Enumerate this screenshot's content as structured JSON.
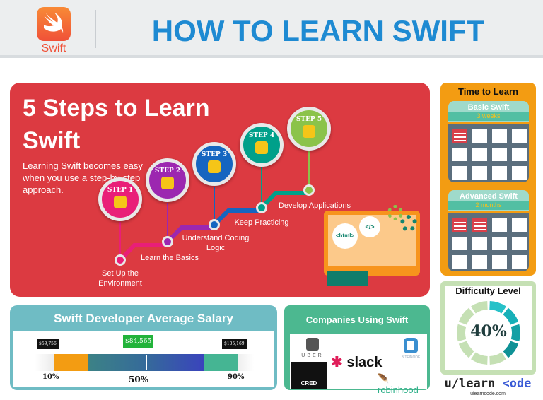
{
  "header": {
    "logo_text": "Swift",
    "title": "HOW TO LEARN SWIFT"
  },
  "steps_panel": {
    "title": "5 Steps to Learn Swift",
    "subtitle": "Learning Swift becomes easy when you use a step-by-step approach.",
    "steps": [
      {
        "badge": "STEP 1",
        "label": "Set Up the Environment",
        "color": "#e91e78",
        "icon": "lightbulb-icon"
      },
      {
        "badge": "STEP 2",
        "label": "Learn the Basics",
        "color": "#9c27b0",
        "icon": "presentation-chart-icon"
      },
      {
        "badge": "STEP 3",
        "label": "Understand Coding Logic",
        "color": "#1565c0",
        "icon": "magnifier-code-icon"
      },
      {
        "badge": "STEP 4",
        "label": "Keep Practicing",
        "color": "#00a08a",
        "icon": "notebook-icon"
      },
      {
        "badge": "STEP 5",
        "label": "Develop Applications",
        "color": "#8bc34a",
        "icon": "globe-gear-icon"
      }
    ],
    "illustration": {
      "html_tag": "<html>",
      "code_tag": "</>"
    }
  },
  "time_to_learn": {
    "title": "Time to Learn",
    "cards": [
      {
        "name": "Basic Swift",
        "duration": "3 weeks",
        "marked": 1
      },
      {
        "name": "Advanced Swift",
        "duration": "2 months",
        "marked": 2
      }
    ]
  },
  "difficulty": {
    "title": "Difficulty Level",
    "value": "40%",
    "percent": 40
  },
  "salary": {
    "title": "Swift Developer Average Salary",
    "markers": [
      {
        "value": "$59,756",
        "percentile": "10%"
      },
      {
        "value": "$84,565",
        "percentile": "50%"
      },
      {
        "value": "$105,169",
        "percentile": "90%"
      }
    ]
  },
  "companies": {
    "title": "Companies Using Swift",
    "logos": [
      "UBER",
      "slack",
      "BITFINODE",
      "CRED",
      "robinhood"
    ]
  },
  "brand": {
    "name_a": "u/learn",
    "name_b": "<ode",
    "url": "ulearncode.com"
  },
  "colors": {
    "red": "#dc3a41",
    "orange": "#f39c12",
    "blue": "#1e8ad2",
    "teal": "#6fbcc4",
    "green": "#4cb890"
  }
}
